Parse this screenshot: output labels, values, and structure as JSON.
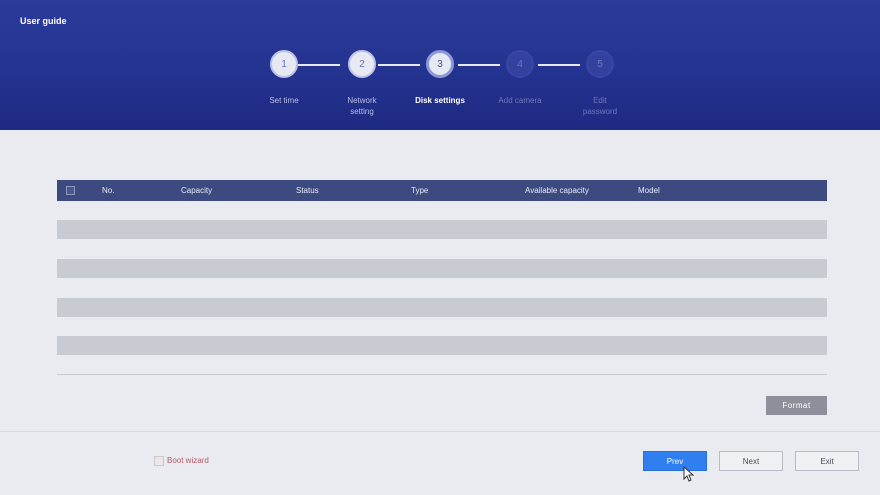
{
  "window": {
    "title": "User guide"
  },
  "stepper": {
    "steps": [
      {
        "number": "1",
        "label": "Set time",
        "state": "done"
      },
      {
        "number": "2",
        "label": "Network setting",
        "label_line1": "Network",
        "label_line2": "setting",
        "state": "done"
      },
      {
        "number": "3",
        "label": "Disk settings",
        "state": "active"
      },
      {
        "number": "4",
        "label": "Add camera",
        "state": "todo"
      },
      {
        "number": "5",
        "label": "Edit password",
        "label_line1": "Edit",
        "label_line2": "password",
        "state": "todo"
      }
    ]
  },
  "table": {
    "columns": [
      "No.",
      "Capacity",
      "Status",
      "Type",
      "Available capacity",
      "Model"
    ],
    "rows": []
  },
  "actions": {
    "format_label": "Format",
    "boot_wizard_label": "Boot wizard",
    "prev_label": "Prev",
    "next_label": "Next",
    "exit_label": "Exit"
  },
  "colors": {
    "header_bg": "#24328f",
    "table_header_bg": "#3c4a80",
    "primary_button": "#2f7ff0",
    "boot_wizard_text": "#b25c6a"
  }
}
